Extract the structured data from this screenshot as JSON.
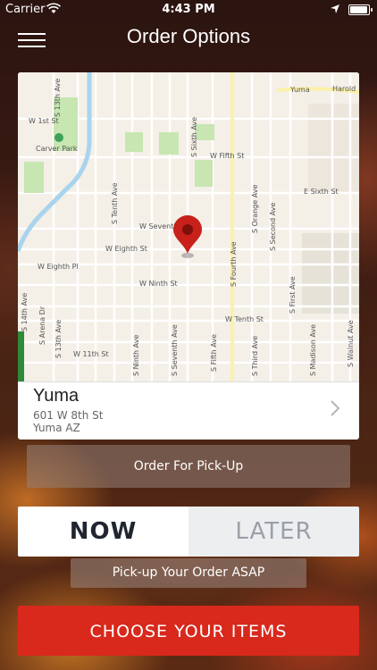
{
  "status_bar": {
    "carrier": "Carrier",
    "time": "4:43 PM",
    "battery_level": 1.0
  },
  "nav": {
    "title": "Order Options",
    "menu_icon": "hamburger-icon"
  },
  "map": {
    "city_label": "Yuma",
    "park_label": "Carver Park",
    "streets": [
      "W Eighth Pl",
      "W Eighth St",
      "W Ninth St",
      "W Seventh",
      "W Tenth St",
      "W 11th St",
      "W Fifth St",
      "E Sixth St",
      "W 1st St",
      "S Fourth Ave",
      "S Fifth Ave",
      "S Sixth Ave",
      "S Seventh Ave",
      "S Ninth Ave",
      "S Tenth Ave",
      "S 13th Ave",
      "S 14th Ave",
      "S Arena Dr",
      "S Orange Ave",
      "S Second Ave",
      "S First Ave",
      "S Third Ave",
      "S Madison Ave",
      "S Walnut Ave",
      "S 13th Ave",
      "Harold"
    ],
    "pin_icon": "map-pin-icon"
  },
  "location": {
    "name": "Yuma",
    "address_line1": "601 W 8th St",
    "address_line2": "Yuma AZ",
    "chevron_icon": "chevron-right-icon"
  },
  "pickup_label": "Order For Pick-Up",
  "timing": {
    "now_label": "NOW",
    "later_label": "LATER",
    "selected": "NOW"
  },
  "asap_label": "Pick-up Your Order ASAP",
  "cta_label": "CHOOSE YOUR ITEMS",
  "colors": {
    "accent_red": "#d9281c",
    "pin_red": "#c8201a"
  }
}
